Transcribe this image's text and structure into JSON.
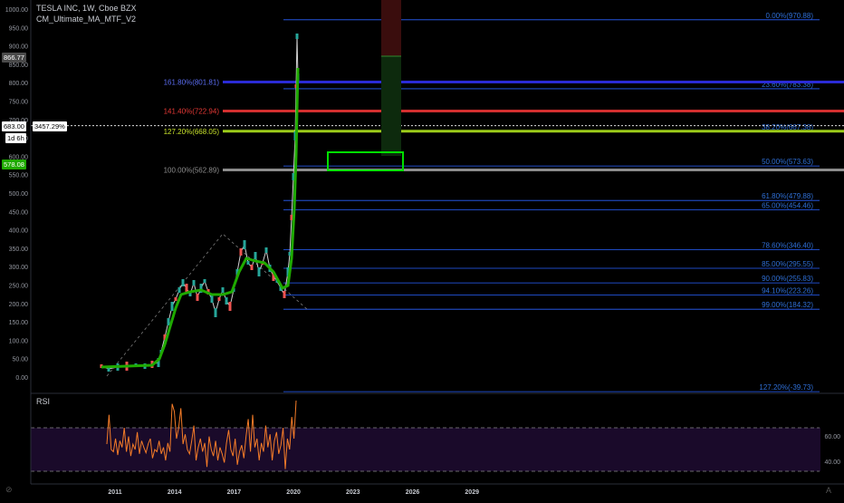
{
  "header": {
    "title": "TESLA INC, 1W, Cboe BZX",
    "indicator": "CM_Ultimate_MA_MTF_V2"
  },
  "price_axis": {
    "ticks": [
      "1000.00",
      "950.00",
      "900.00",
      "850.00",
      "800.00",
      "750.00",
      "700.00",
      "650.00",
      "600.00",
      "550.00",
      "500.00",
      "450.00",
      "400.00",
      "350.00",
      "300.00",
      "250.00",
      "200.00",
      "150.00",
      "100.00",
      "50.00",
      "0.00"
    ],
    "tags": {
      "last_price": "866.77",
      "crosshair_price": "683.00",
      "crosshair_pct": "3457.29%",
      "crosshair_time": "1d 6h",
      "green_price": "578.08"
    }
  },
  "time_axis": {
    "ticks": [
      "2011",
      "2014",
      "2017",
      "2020",
      "2023",
      "2026",
      "2029"
    ]
  },
  "fib_right": [
    {
      "label": "0.00%(970.88)",
      "price": 970.88,
      "color": "#2962ff"
    },
    {
      "label": "23.60%(783.38)",
      "price": 783.38,
      "color": "#2962ff"
    },
    {
      "label": "38.20%(667.38)",
      "price": 667.38,
      "color": "#2962ff"
    },
    {
      "label": "50.00%(573.63)",
      "price": 573.63,
      "color": "#2962ff"
    },
    {
      "label": "61.80%(479.88)",
      "price": 479.88,
      "color": "#2962ff"
    },
    {
      "label": "65.00%(454.46)",
      "price": 454.46,
      "color": "#2962ff"
    },
    {
      "label": "78.60%(346.40)",
      "price": 346.4,
      "color": "#2962ff"
    },
    {
      "label": "85.00%(295.55)",
      "price": 295.55,
      "color": "#2962ff"
    },
    {
      "label": "90.00%(255.83)",
      "price": 255.83,
      "color": "#2962ff"
    },
    {
      "label": "94.10%(223.26)",
      "price": 223.26,
      "color": "#2962ff"
    },
    {
      "label": "99.00%(184.32)",
      "price": 184.32,
      "color": "#2962ff"
    },
    {
      "label": "127.20%(-39.73)",
      "price": -39.73,
      "color": "#2962ff"
    }
  ],
  "fib_ext": [
    {
      "label": "161.80%(801.81)",
      "price": 801.81,
      "color": "#2b2bd6",
      "text_color": "#5a6cf0"
    },
    {
      "label": "141.40%(722.94)",
      "price": 722.94,
      "color": "#d32f2f",
      "text_color": "#e53935"
    },
    {
      "label": "127.20%(668.05)",
      "price": 668.05,
      "color": "#9ccc1a",
      "text_color": "#c6e02b"
    },
    {
      "label": "100.00%(562.89)",
      "price": 562.89,
      "color": "#8c8c8c",
      "text_color": "#8c8c8c"
    }
  ],
  "rsi": {
    "label": "RSI",
    "ticks": [
      "60.00",
      "40.00"
    ],
    "upper": 70,
    "lower": 30,
    "values": [
      55,
      82,
      50,
      48,
      60,
      45,
      58,
      52,
      70,
      48,
      62,
      44,
      55,
      50,
      66,
      46,
      58,
      52,
      47,
      55,
      60,
      42,
      50,
      48,
      58,
      46,
      52,
      40,
      56,
      48,
      92,
      85,
      60,
      70,
      88,
      55,
      64,
      50,
      46,
      58,
      72,
      40,
      52,
      60,
      48,
      56,
      34,
      62,
      50,
      44,
      58,
      40,
      52,
      46,
      38,
      56,
      68,
      50,
      44,
      60,
      36,
      48,
      54,
      42,
      62,
      78,
      48,
      82,
      52,
      60,
      40,
      56,
      48,
      72,
      52,
      64,
      40,
      58,
      66,
      46,
      54,
      70,
      32,
      60,
      50,
      80,
      60,
      95
    ]
  },
  "colors": {
    "background": "#000000",
    "up_candle": "#26a69a",
    "down_candle": "#ef5350",
    "ma_green": "#1faa00",
    "rsi_line": "#f57c28",
    "rsi_band": "#1a0a2a",
    "target_box": "#00e000",
    "grid": "#1c1f26"
  }
}
